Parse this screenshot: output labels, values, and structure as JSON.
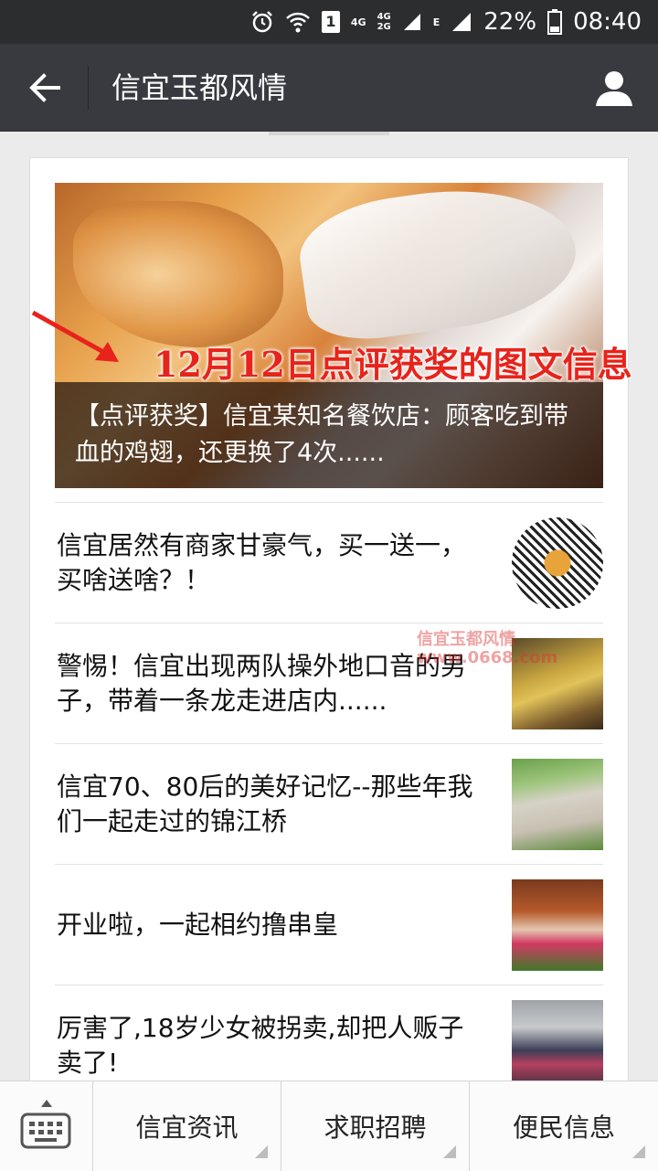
{
  "status_bar": {
    "network_4g": "4G",
    "network_4g_top": "4G",
    "network_2g_bottom": "2G",
    "network_e": "E",
    "sim_slot": "1",
    "battery_percent": "22%",
    "time": "08:40"
  },
  "app_bar": {
    "title": "信宜玉都风情"
  },
  "hero": {
    "annotation": "12月12日点评获奖的图文信息",
    "caption": "【点评获奖】信宜某知名餐饮店：顾客吃到带血的鸡翅，还更换了4次......"
  },
  "articles": [
    {
      "title": "信宜居然有商家甘豪气，买一送一，买啥送啥？！",
      "thumbnail": "qr-code-burger"
    },
    {
      "title": "警惕！信宜出现两队操外地口音的男子，带着一条龙走进店内......",
      "thumbnail": "lion-dance"
    },
    {
      "title": "信宜70、80后的美好记忆--那些年我们一起走过的锦江桥",
      "thumbnail": "bridge"
    },
    {
      "title": "开业啦，一起相约撸串皇",
      "thumbnail": "shop-flowers"
    },
    {
      "title": "厉害了,18岁少女被拐卖,却把人贩子卖了!",
      "thumbnail": "people"
    }
  ],
  "watermark": {
    "line1": "信宜玉都风情",
    "line2": "www.0668.com"
  },
  "bottom_menu": [
    {
      "label": "信宜资讯"
    },
    {
      "label": "求职招聘"
    },
    {
      "label": "便民信息"
    }
  ],
  "colors": {
    "status_bar_bg": "#2b2d2f",
    "app_bar_bg": "#393a3f",
    "annotation_red": "#e8231b"
  }
}
